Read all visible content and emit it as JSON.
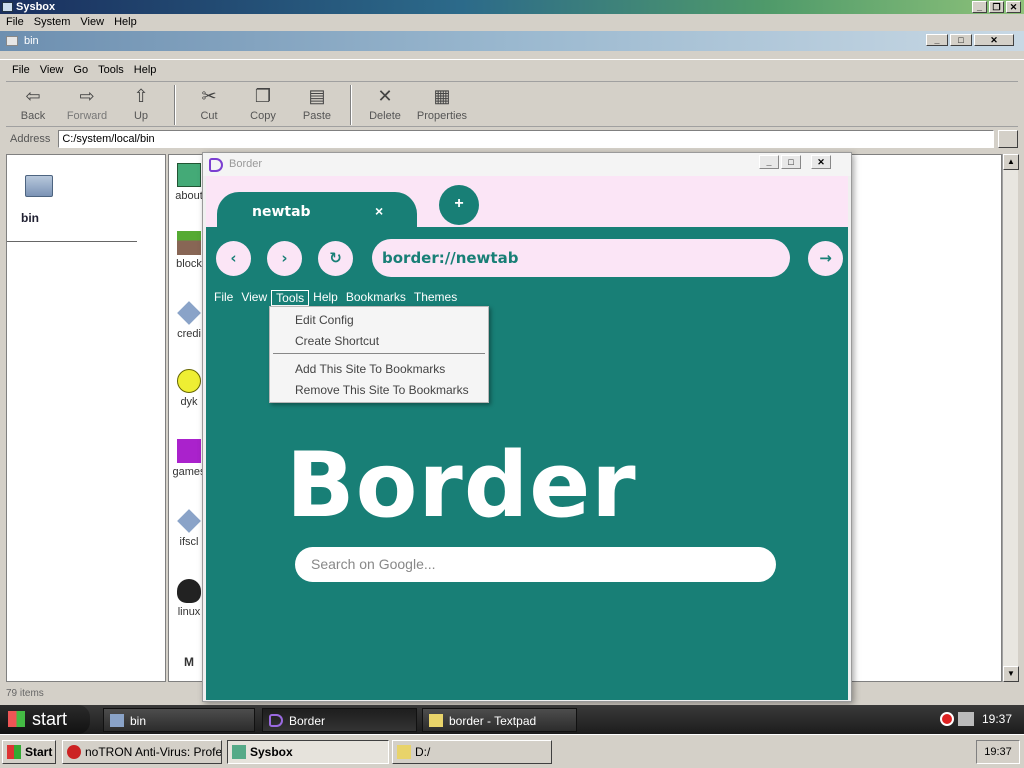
{
  "sysbox": {
    "title": "Sysbox",
    "menu": [
      "File",
      "System",
      "View",
      "Help"
    ]
  },
  "file_manager": {
    "title": "bin",
    "menu": [
      "File",
      "View",
      "Go",
      "Tools",
      "Help"
    ],
    "toolbar": [
      {
        "label": "Back",
        "icon": "back-arrow-icon"
      },
      {
        "label": "Forward",
        "icon": "forward-arrow-icon"
      },
      {
        "label": "Up",
        "icon": "up-folder-icon"
      },
      {
        "label": "Cut",
        "icon": "scissors-icon"
      },
      {
        "label": "Copy",
        "icon": "copy-icon"
      },
      {
        "label": "Paste",
        "icon": "paste-icon"
      },
      {
        "label": "Delete",
        "icon": "delete-x-icon"
      },
      {
        "label": "Properties",
        "icon": "properties-icon"
      }
    ],
    "address_label": "Address",
    "address_value": "C:/system/local/bin",
    "left_folder": "bin",
    "files": [
      "about",
      "block",
      "credi",
      "dyk",
      "games",
      "ifscl",
      "linux",
      "M"
    ],
    "status": "79 items"
  },
  "browser": {
    "title": "Border",
    "tab_label": "newtab",
    "tab_close": "×",
    "new_tab": "+",
    "url": "border://newtab",
    "menu": [
      "File",
      "View",
      "Tools",
      "Help",
      "Bookmarks",
      "Themes"
    ],
    "dropdown": [
      "Edit Config",
      "Create Shortcut",
      "Add This Site To Bookmarks",
      "Remove This Site To Bookmarks"
    ],
    "logo_text": "Border",
    "search_placeholder": "Search on Google...",
    "colors": {
      "teal": "#187f76",
      "pink": "#fbe5f6"
    }
  },
  "taskbar_top": {
    "start": "start",
    "tasks": [
      "bin",
      "Border",
      "border - Textpad"
    ],
    "clock": "19:37"
  },
  "taskbar_bottom": {
    "start": "Start",
    "tasks": [
      "noTRON Anti-Virus: Profes...",
      "Sysbox",
      "D:/"
    ],
    "clock": "19:37"
  }
}
